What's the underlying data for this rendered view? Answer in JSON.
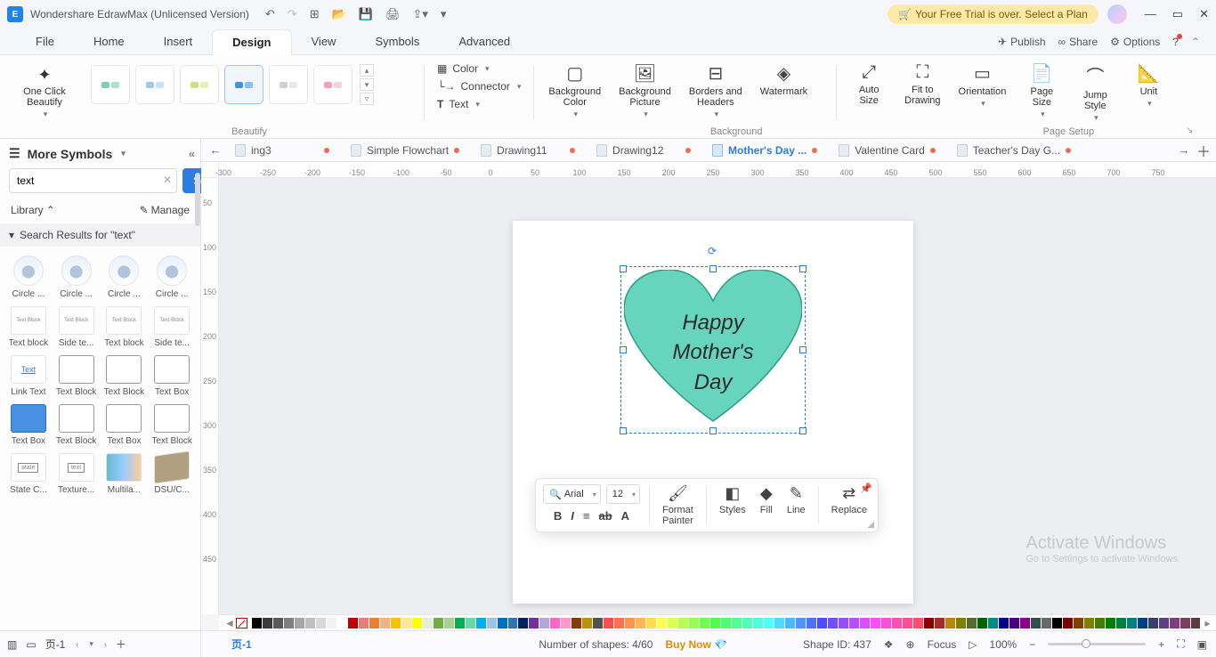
{
  "app": {
    "title": "Wondershare EdrawMax (Unlicensed Version)"
  },
  "trial_notice": "Your Free Trial is over. Select a Plan",
  "menu": {
    "items": [
      "File",
      "Home",
      "Insert",
      "Design",
      "View",
      "Symbols",
      "Advanced"
    ],
    "active": "Design",
    "right": {
      "publish": "Publish",
      "share": "Share",
      "options": "Options"
    }
  },
  "ribbon": {
    "beautify": {
      "label": "One Click\nBeautify",
      "group": "Beautify"
    },
    "panel_color": "Color",
    "panel_connector": "Connector",
    "panel_text": "Text",
    "bg_color": "Background\nColor",
    "bg_picture": "Background\nPicture",
    "borders": "Borders and\nHeaders",
    "watermark": "Watermark",
    "bg_group": "Background",
    "autosize": "Auto\nSize",
    "fit": "Fit to\nDrawing",
    "orientation": "Orientation",
    "pagesize": "Page\nSize",
    "jump": "Jump\nStyle",
    "unit": "Unit",
    "setup_group": "Page Setup"
  },
  "symbols_panel": {
    "title": "More Symbols",
    "search_value": "text",
    "search_btn": "Search",
    "library": "Library",
    "manage": "Manage",
    "section": "Search Results for  \"text\"",
    "items": [
      "Circle ...",
      "Circle ...",
      "Circle ...",
      "Circle ...",
      "Text block",
      "Side te...",
      "Text block",
      "Side te...",
      "Link Text",
      "Text Block",
      "Text Block",
      "Text Box",
      "Text Box",
      "Text Block",
      "Text Box",
      "Text Block",
      "State C...",
      "Texture...",
      "Multila...",
      "DSU/C..."
    ]
  },
  "doc_tabs": {
    "items": [
      {
        "label": "ing3",
        "active": false
      },
      {
        "label": "Simple Flowchart",
        "active": false
      },
      {
        "label": "Drawing11",
        "active": false
      },
      {
        "label": "Drawing12",
        "active": false
      },
      {
        "label": "Mother's Day ...",
        "active": true
      },
      {
        "label": "Valentine Card",
        "active": false
      },
      {
        "label": "Teacher's Day G...",
        "active": false
      }
    ]
  },
  "h_ruler": [
    "-300",
    "-250",
    "-200",
    "-150",
    "-100",
    "-50",
    "0",
    "50",
    "100",
    "150",
    "200",
    "250",
    "300",
    "350",
    "400",
    "450",
    "500",
    "550",
    "600",
    "650",
    "700",
    "750"
  ],
  "v_ruler": [
    "50",
    "100",
    "150",
    "200",
    "250",
    "300",
    "350",
    "400",
    "450"
  ],
  "heart": {
    "line1": "Happy",
    "line2": "Mother's",
    "line3": "Day"
  },
  "float_toolbar": {
    "font": "Arial",
    "size": "12",
    "format_painter": "Format\nPainter",
    "styles": "Styles",
    "fill": "Fill",
    "line": "Line",
    "replace": "Replace"
  },
  "status": {
    "page_left": "页-1",
    "page_tab": "页-1",
    "shapes": "Number of shapes: 4/60",
    "buy": "Buy Now",
    "shape_id": "Shape ID: 437",
    "focus": "Focus",
    "zoom": "100%"
  },
  "activate": {
    "t": "Activate Windows",
    "s": "Go to Settings to activate Windows."
  },
  "colors": [
    "#000000",
    "#3b3b3b",
    "#595959",
    "#7f7f7f",
    "#a5a5a5",
    "#bfbfbf",
    "#d8d8d8",
    "#f2f2f2",
    "#ffffff",
    "#c00000",
    "#e97c7c",
    "#ed7d31",
    "#f4b183",
    "#ffc000",
    "#ffe699",
    "#ffff00",
    "#e2f0d9",
    "#70ad47",
    "#a9d18e",
    "#00b050",
    "#66d9a6",
    "#00b0f0",
    "#9dc3e6",
    "#0070c0",
    "#2e75b6",
    "#002060",
    "#7030a0",
    "#b4a7d6",
    "#ff66cc",
    "#ff99cc",
    "#833c0c",
    "#bf9000",
    "#525252"
  ],
  "palette_extra": [
    "#ff4d4d",
    "#ff704d",
    "#ff944d",
    "#ffb84d",
    "#ffdb4d",
    "#ffff4d",
    "#dbff4d",
    "#b8ff4d",
    "#94ff4d",
    "#70ff4d",
    "#4dff4d",
    "#4dff70",
    "#4dff94",
    "#4dffb8",
    "#4dffdb",
    "#4dffff",
    "#4ddbff",
    "#4db8ff",
    "#4d94ff",
    "#4d70ff",
    "#4d4dff",
    "#704dff",
    "#944dff",
    "#b84dff",
    "#db4dff",
    "#ff4dff",
    "#ff4ddb",
    "#ff4db8",
    "#ff4d94",
    "#ff4d70",
    "#8b0000",
    "#a52a2a",
    "#b8860b",
    "#808000",
    "#556b2f",
    "#006400",
    "#008b8b",
    "#00008b",
    "#4b0082",
    "#8b008b",
    "#2f4f4f",
    "#696969",
    "#000000",
    "#800000",
    "#804000",
    "#808000",
    "#408000",
    "#008000",
    "#008040",
    "#008080",
    "#004080",
    "#3c3c70",
    "#5c4080",
    "#803c80",
    "#803c5c",
    "#5c3c3c"
  ]
}
